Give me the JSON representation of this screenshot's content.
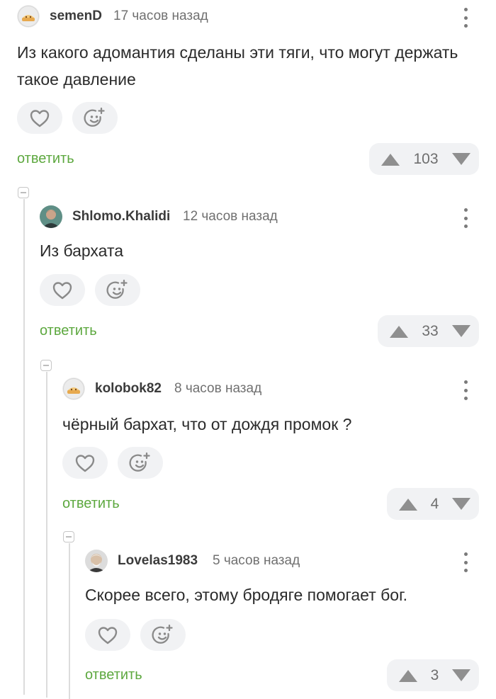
{
  "comments": [
    {
      "username": "semenD",
      "timestamp": "17 часов назад",
      "text": "Из какого адомантия сделаны эти тяги, что могут держать такое давление",
      "reply_label": "ответить",
      "rating": "103",
      "avatar_icon": "pie-avatar-icon"
    },
    {
      "username": "Shlomo.Khalidi",
      "timestamp": "12 часов назад",
      "text": "Из бархата",
      "reply_label": "ответить",
      "rating": "33",
      "avatar_icon": "user-photo-avatar-icon"
    },
    {
      "username": "kolobok82",
      "timestamp": "8 часов назад",
      "text": "чёрный бархат, что от дождя промок ?",
      "reply_label": "ответить",
      "rating": "4",
      "avatar_icon": "pie-avatar-icon"
    },
    {
      "username": "Lovelas1983",
      "timestamp": "5 часов назад",
      "text": "Скорее всего, этому бродяге помогает бог.",
      "reply_label": "ответить",
      "rating": "3",
      "avatar_icon": "user-photo-avatar-icon"
    }
  ],
  "colors": {
    "reply_link": "#5da83f",
    "pill_background": "#f1f2f4",
    "icon_gray": "#8a8a8a",
    "thread_line": "#dcdcdc"
  }
}
